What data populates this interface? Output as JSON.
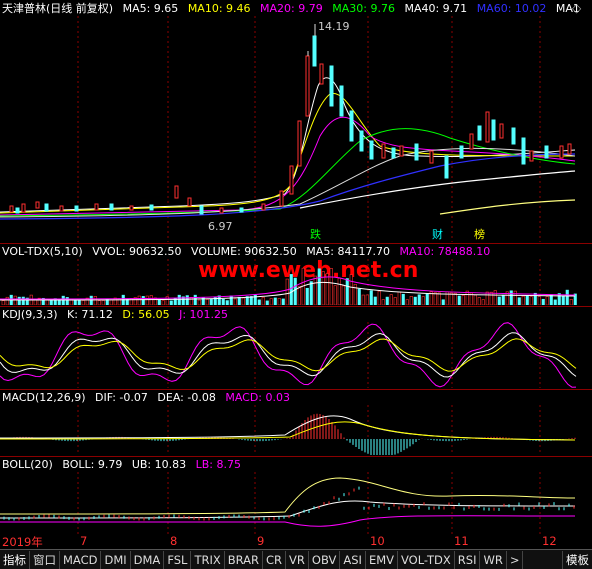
{
  "main_header": {
    "title": "天津普林(日线 前复权)",
    "ma5": "MA5: 9.65",
    "ma10": "MA10: 9.46",
    "ma20": "MA20: 9.79",
    "ma30": "MA30: 9.76",
    "ma40": "MA40: 9.71",
    "ma60": "MA60: 10.02",
    "ma_more": "MA1",
    "icon": "diamond-icon"
  },
  "price_annotations": {
    "high": "14.19",
    "low": "6.97"
  },
  "event_labels": [
    "跌",
    "财",
    "榜"
  ],
  "vol_header": {
    "name": "VOL-TDX(5,10)",
    "vvol": "VVOL: 90632.50",
    "volume": "VOLUME: 90632.50",
    "ma5": "MA5: 84117.70",
    "ma10": "MA10: 78488.10"
  },
  "watermark": "www.eweb.net.cn",
  "kdj_header": {
    "name": "KDJ(9,3,3)",
    "k": "K: 71.12",
    "d": "D: 56.05",
    "j": "J: 101.25"
  },
  "macd_header": {
    "name": "MACD(12,26,9)",
    "dif": "DIF: -0.07",
    "dea": "DEA: -0.08",
    "macd": "MACD: 0.03"
  },
  "boll_header": {
    "name": "BOLL(20)",
    "boll": "BOLL: 9.79",
    "ub": "UB: 10.83",
    "lb": "LB: 8.75"
  },
  "date_axis": [
    "2019年",
    "7",
    "8",
    "9",
    "10",
    "11",
    "12"
  ],
  "bottom_tabs": [
    "指标",
    "窗口",
    "MACD",
    "DMI",
    "DMA",
    "FSL",
    "TRIX",
    "BRAR",
    "CR",
    "VR",
    "OBV",
    "ASI",
    "EMV",
    "VOL-TDX",
    "RSI",
    "WR",
    ">"
  ],
  "template_button": "模板",
  "colors": {
    "ma5": "#ffffff",
    "ma10": "#ffff00",
    "ma20": "#ff00ff",
    "ma30": "#00ff00",
    "ma40": "#ffffff",
    "ma60": "#0000ff",
    "up": "#ff3030",
    "down": "#54ffff",
    "grid": "#8b0000",
    "watermark": "#ff0000"
  }
}
